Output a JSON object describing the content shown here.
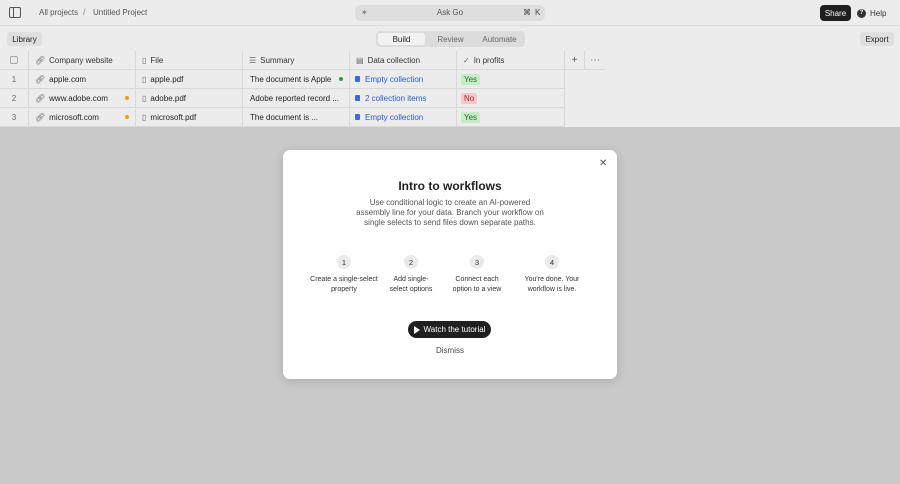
{
  "topbar": {
    "breadcrumb": [
      "All projects",
      "Untitled Project"
    ],
    "ask_label": "Ask Go",
    "ask_shortcut_mod": "⌘",
    "ask_shortcut_key": "K",
    "share_label": "Share",
    "help_label": "Help"
  },
  "toolbar": {
    "library_label": "Library",
    "tabs": [
      "Build",
      "Review",
      "Automate"
    ],
    "active_tab": "Build",
    "export_label": "Export"
  },
  "table": {
    "columns": [
      "Company website",
      "File",
      "Summary",
      "Data collection",
      "In profits"
    ],
    "rows": [
      {
        "num": "1",
        "website": "apple.com",
        "file": "apple.pdf",
        "summary": "The document is Apple...",
        "collection": "Empty collection",
        "profit": "Yes"
      },
      {
        "num": "2",
        "website": "www.adobe.com",
        "file": "adobe.pdf",
        "summary": "Adobe reported record ...",
        "collection": "2 collection items",
        "profit": "No"
      },
      {
        "num": "3",
        "website": "microsoft.com",
        "file": "microsoft.pdf",
        "summary": "The document is ...",
        "collection": "Empty collection",
        "profit": "Yes"
      }
    ]
  },
  "modal": {
    "title": "Intro to workflows",
    "description": "Use conditional logic to create an AI-powered assembly line for your data. Branch your workflow on single selects to send files down separate paths.",
    "steps": [
      {
        "num": "1",
        "text": "Create a single-select property"
      },
      {
        "num": "2",
        "text": "Add single-select options"
      },
      {
        "num": "3",
        "text": "Connect each option to a view"
      },
      {
        "num": "4",
        "text": "You're done. Your workflow is live."
      }
    ],
    "watch_label": "Watch the tutorial",
    "dismiss_label": "Dismiss"
  },
  "colors": {
    "accent": "#1f1f1f",
    "link": "#2a5bd8",
    "yes_bg": "#c6ecc7",
    "no_bg": "#f7c7c7"
  }
}
